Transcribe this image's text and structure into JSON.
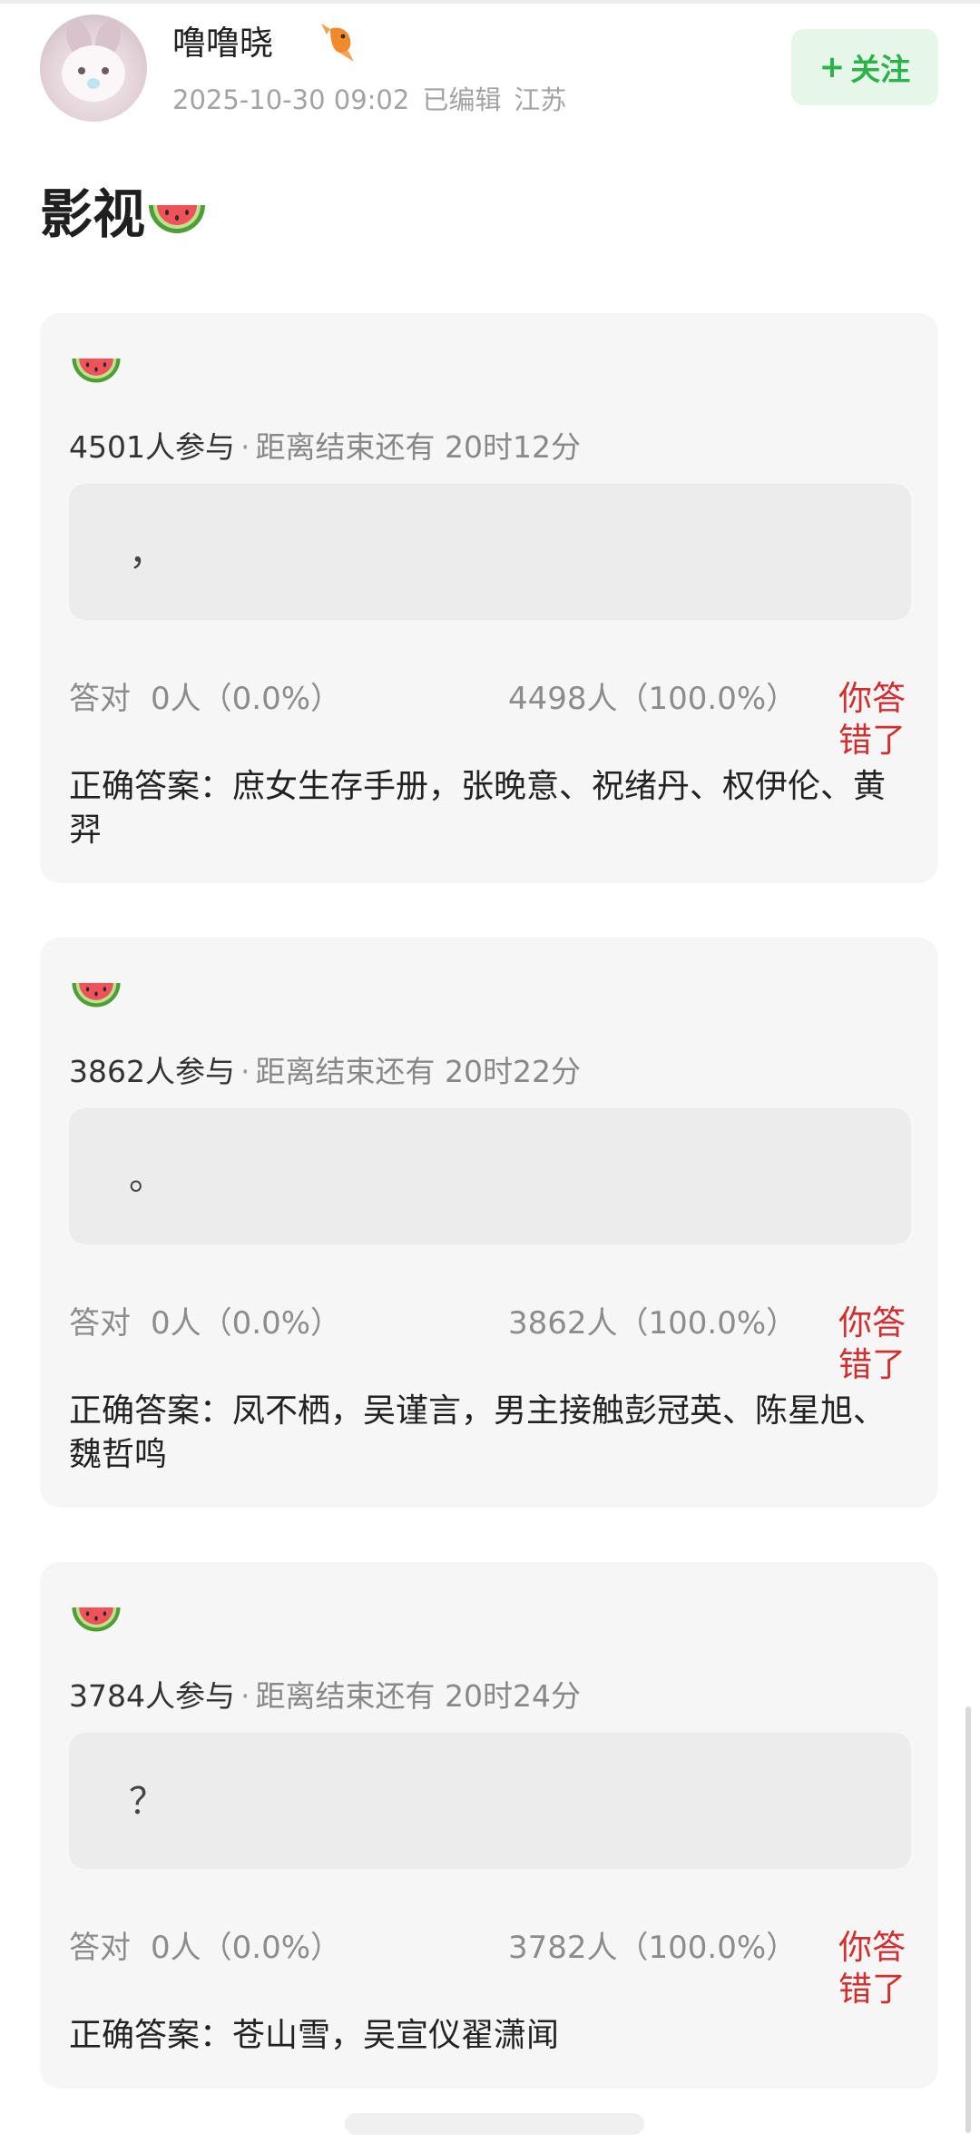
{
  "post": {
    "username": "噜噜晓",
    "badge_icon": "goldfish-icon",
    "date": "2025-10-30 09:02",
    "edited": "已编辑",
    "location": "江苏",
    "follow_label": "关注",
    "title": "影视"
  },
  "quizzes": [
    {
      "participants": "4501人参与",
      "separator": "·",
      "remaining": "距离结束还有 20时12分",
      "question": "，",
      "option_a_label": "答对",
      "option_a_count": "0人（0.0%）",
      "option_b_count": "4498人（100.0%）",
      "result": "你答错了",
      "answer": "正确答案：庶女生存手册，张晚意、祝绪丹、权伊伦、黄羿"
    },
    {
      "participants": "3862人参与",
      "separator": "·",
      "remaining": "距离结束还有 20时22分",
      "question": "。",
      "option_a_label": "答对",
      "option_a_count": "0人（0.0%）",
      "option_b_count": "3862人（100.0%）",
      "result": "你答错了",
      "answer": "正确答案：凤不栖，吴谨言，男主接触彭冠英、陈星旭、魏哲鸣"
    },
    {
      "participants": "3784人参与",
      "separator": "·",
      "remaining": "距离结束还有 20时24分",
      "question": "？",
      "option_a_label": "答对",
      "option_a_count": "0人（0.0%）",
      "option_b_count": "3782人（100.0%）",
      "result": "你答错了",
      "answer": "正确答案：苍山雪，吴宣仪翟潇闻"
    }
  ],
  "colors": {
    "follow_green": "#2bb34b",
    "wrong_red": "#d12f2f",
    "card_bg": "#f6f6f6"
  }
}
